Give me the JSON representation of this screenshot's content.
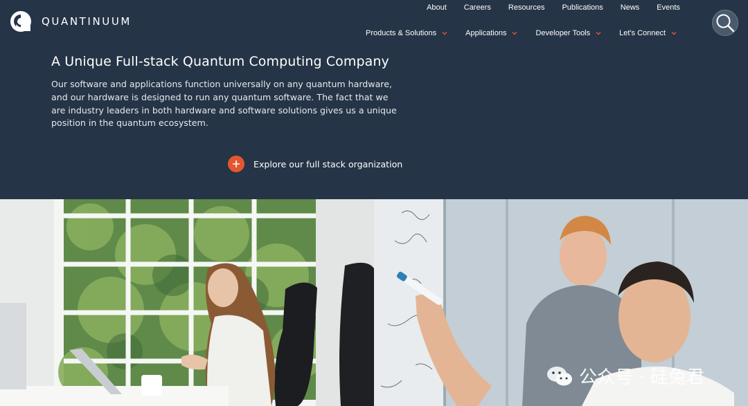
{
  "brand": {
    "name": "QUANTINUUM"
  },
  "utility_nav": [
    "About",
    "Careers",
    "Resources",
    "Publications",
    "News",
    "Events"
  ],
  "main_nav": [
    {
      "label": "Products & Solutions"
    },
    {
      "label": "Applications"
    },
    {
      "label": "Developer Tools"
    },
    {
      "label": "Let's Connect"
    }
  ],
  "search": {
    "icon": "search-icon"
  },
  "hero": {
    "title": "A Unique Full-stack Quantum Computing Company",
    "body": "Our software and applications function universally on any quantum hardware, and our hardware is designed to run any quantum software. The fact that we are industry leaders in both hardware and software solutions gives us a unique position in the quantum ecosystem.",
    "cta_label": "Explore our full stack organization"
  },
  "watermark": {
    "text": "公众号 · 硅兔君"
  },
  "colors": {
    "background": "#253446",
    "accent": "#e4572e",
    "chevron": "#e4572e"
  }
}
